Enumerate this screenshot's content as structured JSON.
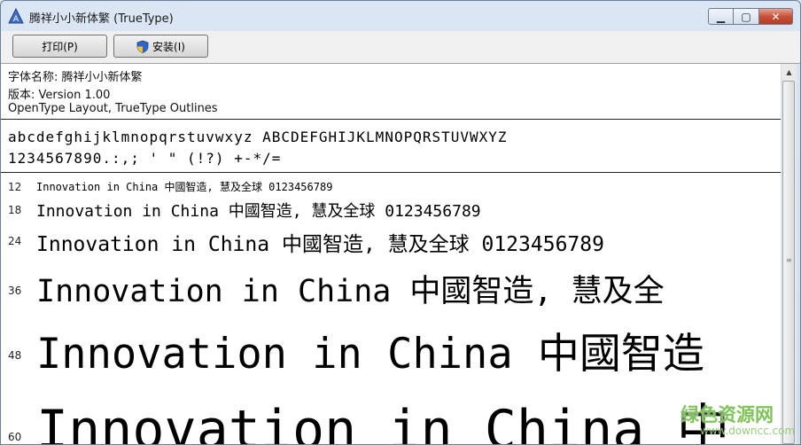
{
  "window": {
    "title": "腾祥小小新体繁 (TrueType)",
    "minimize_symbol": "▁",
    "maximize_symbol": "▢",
    "close_symbol": "✕"
  },
  "toolbar": {
    "print_label": "打印(P)",
    "install_label": "安装(I)",
    "install_icon": "shield-icon"
  },
  "font_info": {
    "name_line": "字体名称: 腾祥小小新体繁",
    "version_line": "版本: Version 1.00",
    "format_line": "OpenType Layout, TrueType Outlines"
  },
  "charset": {
    "letters": "abcdefghijklmnopqrstuvwxyz ABCDEFGHIJKLMNOPQRSTUVWXYZ",
    "digits": "1234567890.:,; ' \" (!?) +-*/="
  },
  "samples": [
    {
      "size": "12",
      "text": "Innovation in China 中國智造, 慧及全球 0123456789"
    },
    {
      "size": "18",
      "text": "Innovation in China 中國智造, 慧及全球 0123456789"
    },
    {
      "size": "24",
      "text": "Innovation in China 中國智造, 慧及全球 0123456789"
    },
    {
      "size": "36",
      "text": "Innovation in China 中國智造, 慧及全"
    },
    {
      "size": "48",
      "text": "Innovation in China 中國智造"
    },
    {
      "size": "60",
      "text": "Innovation in China 中"
    }
  ],
  "watermark": {
    "text": "绿色资源网",
    "url": "www.downcc.com"
  }
}
